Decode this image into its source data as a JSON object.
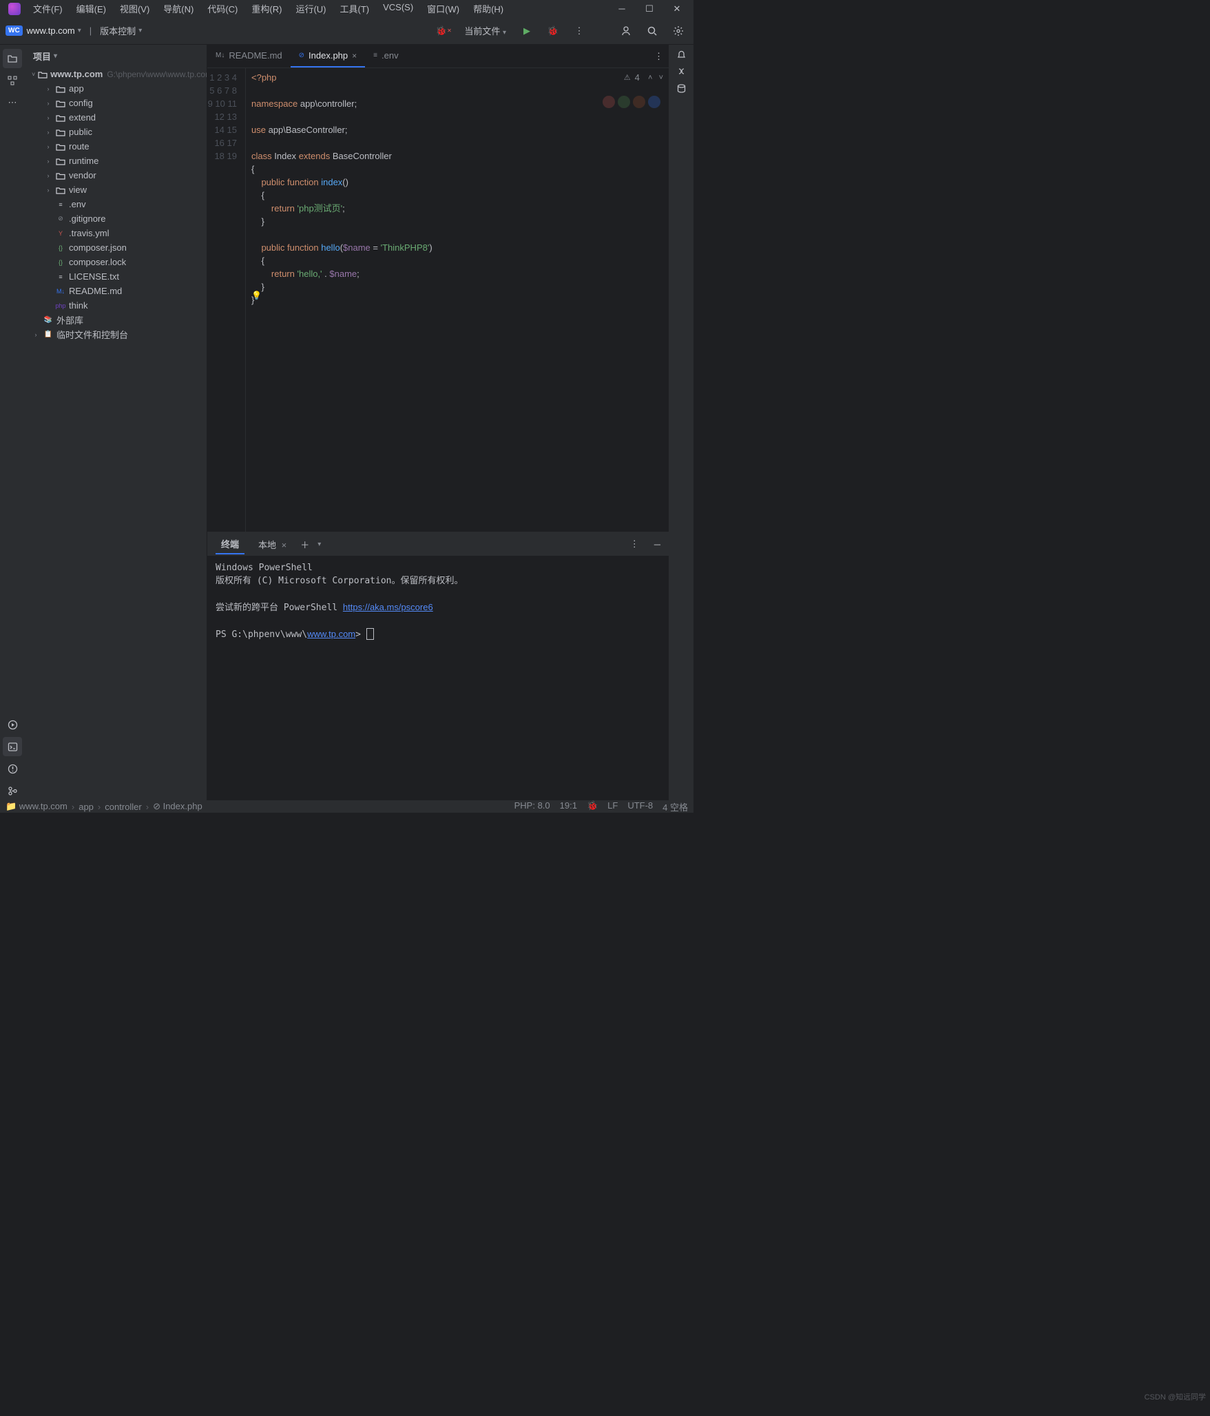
{
  "menu": [
    "文件(F)",
    "编辑(E)",
    "视图(V)",
    "导航(N)",
    "代码(C)",
    "重构(R)",
    "运行(U)",
    "工具(T)",
    "VCS(S)",
    "窗口(W)",
    "帮助(H)"
  ],
  "navbar": {
    "project": "www.tp.com",
    "vcs": "版本控制",
    "current_file": "当前文件"
  },
  "sidebar": {
    "title": "项目"
  },
  "tree": {
    "root": {
      "name": "www.tp.com",
      "path": "G:\\phpenv\\www\\www.tp.com"
    },
    "dirs": [
      "app",
      "config",
      "extend",
      "public",
      "route",
      "runtime",
      "vendor",
      "view"
    ],
    "files": [
      {
        "n": ".env",
        "i": "list"
      },
      {
        "n": ".gitignore",
        "i": "ignore"
      },
      {
        "n": ".travis.yml",
        "i": "yml"
      },
      {
        "n": "composer.json",
        "i": "json"
      },
      {
        "n": "composer.lock",
        "i": "json"
      },
      {
        "n": "LICENSE.txt",
        "i": "list"
      },
      {
        "n": "README.md",
        "i": "md"
      },
      {
        "n": "think",
        "i": "php"
      }
    ],
    "extra": [
      "外部库",
      "临时文件和控制台"
    ]
  },
  "tabs": [
    {
      "label": "README.md",
      "icon": "M↓",
      "active": false,
      "close": false
    },
    {
      "label": "Index.php",
      "icon": "⊘",
      "active": true,
      "close": true
    },
    {
      "label": ".env",
      "icon": "≡",
      "active": false,
      "close": false
    }
  ],
  "inspection": {
    "warn": "4"
  },
  "code_lines": 19,
  "terminal": {
    "title": "终端",
    "tab": "本地",
    "l1": "Windows PowerShell",
    "l2": "版权所有 (C) Microsoft Corporation。保留所有权利。",
    "l3a": "尝试新的跨平台 PowerShell ",
    "l3link": "https://aka.ms/pscore6",
    "l4a": "PS G:\\phpenv\\www\\",
    "l4link": "www.tp.com",
    "l4b": "> "
  },
  "breadcrumb": [
    "www.tp.com",
    "app",
    "controller",
    "Index.php"
  ],
  "status": {
    "php": "PHP: 8.0",
    "pos": "19:1",
    "lf": "LF",
    "enc": "UTF-8",
    "spaces": "4 空格"
  },
  "watermark": "CSDN @知远同学"
}
